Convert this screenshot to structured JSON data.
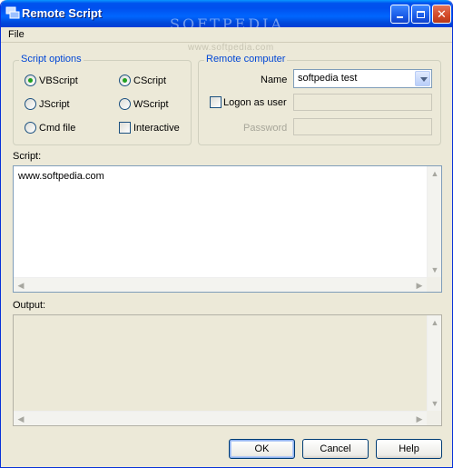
{
  "window": {
    "title": "Remote Script",
    "watermark": "SOFTPEDIA",
    "watermark_sub": "www.softpedia.com"
  },
  "menu": {
    "file": "File"
  },
  "script_options": {
    "label": "Script options",
    "vbscript": "VBScript",
    "cscript": "CScript",
    "jscript": "JScript",
    "wscript": "WScript",
    "cmdfile": "Cmd file",
    "interactive": "Interactive",
    "selected_language": "VBScript",
    "selected_host": "CScript",
    "interactive_checked": false
  },
  "remote_computer": {
    "label": "Remote computer",
    "name_label": "Name",
    "name_value": "softpedia test",
    "logon_label": "Logon as user",
    "logon_checked": false,
    "password_label": "Password",
    "user_value": "",
    "password_value": ""
  },
  "script": {
    "label": "Script:",
    "content": "www.softpedia.com"
  },
  "output": {
    "label": "Output:",
    "content": ""
  },
  "buttons": {
    "ok": "OK",
    "cancel": "Cancel",
    "help": "Help"
  },
  "colors": {
    "title_bar": "#0053ee",
    "group_label": "#0046d5",
    "radio_dot": "#21a121",
    "window_bg": "#ece9d8"
  }
}
